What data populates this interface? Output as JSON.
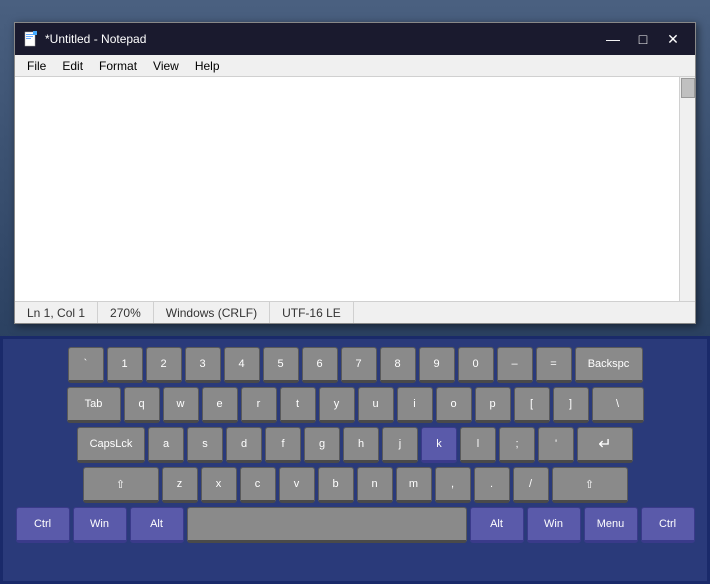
{
  "desktop": {
    "bg_color": "#2a3a5c"
  },
  "window": {
    "title": "*Untitled - Notepad",
    "icon": "notepad-icon"
  },
  "titlebar": {
    "minimize_label": "—",
    "maximize_label": "□",
    "close_label": "✕"
  },
  "menu": {
    "items": [
      "File",
      "Edit",
      "Format",
      "View",
      "Help"
    ]
  },
  "statusbar": {
    "position": "Ln 1, Col 1",
    "zoom": "270%",
    "line_ending": "Windows (CRLF)",
    "encoding": "UTF-16 LE"
  },
  "keyboard": {
    "rows": [
      [
        "`",
        "1",
        "2",
        "3",
        "4",
        "5",
        "6",
        "7",
        "8",
        "9",
        "0",
        "–",
        "=",
        "Backspc"
      ],
      [
        "Tab",
        "q",
        "w",
        "e",
        "r",
        "t",
        "y",
        "u",
        "i",
        "o",
        "p",
        "[",
        "]",
        "\\"
      ],
      [
        "CapsLck",
        "a",
        "s",
        "d",
        "f",
        "g",
        "h",
        "j",
        "k",
        "l",
        ";",
        "'",
        "↵"
      ],
      [
        "⇧",
        "z",
        "x",
        "c",
        "v",
        "b",
        "n",
        "m",
        ",",
        ".",
        "/",
        "⇧"
      ],
      [
        "Ctrl",
        "Win",
        "Alt",
        "",
        "Alt",
        "Win",
        "Menu",
        "Ctrl"
      ]
    ]
  }
}
